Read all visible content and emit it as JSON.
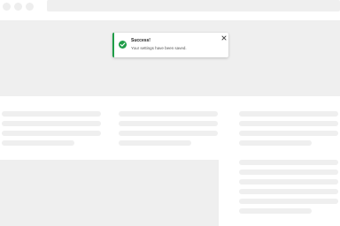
{
  "toast": {
    "status": "success",
    "icon": "check-circle-icon",
    "title": "Success!",
    "message": "Your settings have been saved.",
    "close_icon": "close-icon",
    "accent_color": "#1f9d48"
  },
  "window": {
    "controls": [
      "window-control-dot",
      "window-control-dot",
      "window-control-dot"
    ]
  }
}
